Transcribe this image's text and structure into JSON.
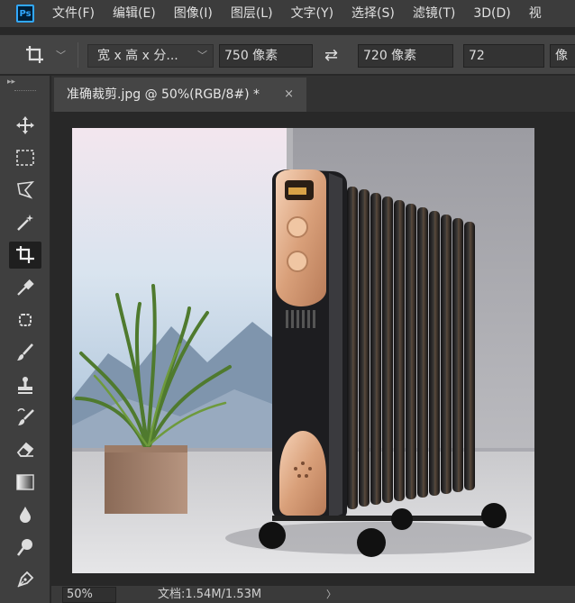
{
  "menu": {
    "items": [
      "文件(F)",
      "编辑(E)",
      "图像(I)",
      "图层(L)",
      "文字(Y)",
      "选择(S)",
      "滤镜(T)",
      "3D(D)",
      "视"
    ]
  },
  "app": {
    "logo_text": "Ps",
    "accent": "#31a8ff"
  },
  "options": {
    "tool_icon": "crop-icon",
    "ratio_select": "宽 x 高 x 分...",
    "width_value": "750 像素",
    "height_value": "720 像素",
    "resolution_value": "72",
    "resolution_unit": "像"
  },
  "tab": {
    "title": "准确裁剪.jpg @ 50%(RGB/8#) *",
    "close_symbol": "×"
  },
  "tools": [
    {
      "name": "move-tool",
      "icon": "move-icon",
      "glyph": "✥"
    },
    {
      "name": "marquee-tool",
      "icon": "marquee-icon",
      "glyph": "⬚"
    },
    {
      "name": "lasso-tool",
      "icon": "lasso-icon",
      "glyph": "⌇"
    },
    {
      "name": "magic-wand-tool",
      "icon": "magic-wand-icon",
      "glyph": "✧"
    },
    {
      "name": "crop-tool",
      "icon": "crop-icon",
      "glyph": "⌗"
    },
    {
      "name": "eyedropper-tool",
      "icon": "eyedropper-icon",
      "glyph": "✎"
    },
    {
      "name": "patch-tool",
      "icon": "patch-icon",
      "glyph": "✲"
    },
    {
      "name": "brush-tool",
      "icon": "brush-icon",
      "glyph": "╱"
    },
    {
      "name": "stamp-tool",
      "icon": "stamp-icon",
      "glyph": "♟"
    },
    {
      "name": "history-brush-tool",
      "icon": "history-brush-icon",
      "glyph": "↺"
    },
    {
      "name": "eraser-tool",
      "icon": "eraser-icon",
      "glyph": "◈"
    },
    {
      "name": "gradient-tool",
      "icon": "gradient-icon",
      "glyph": "▣"
    },
    {
      "name": "blur-tool",
      "icon": "blur-drop-icon",
      "glyph": "●"
    },
    {
      "name": "dodge-tool",
      "icon": "dodge-icon",
      "glyph": "⚲"
    },
    {
      "name": "pen-tool",
      "icon": "pen-icon",
      "glyph": "✒"
    }
  ],
  "status": {
    "zoom": "50%",
    "doc_info": "文档:1.54M/1.53M",
    "arrow": "〉"
  }
}
